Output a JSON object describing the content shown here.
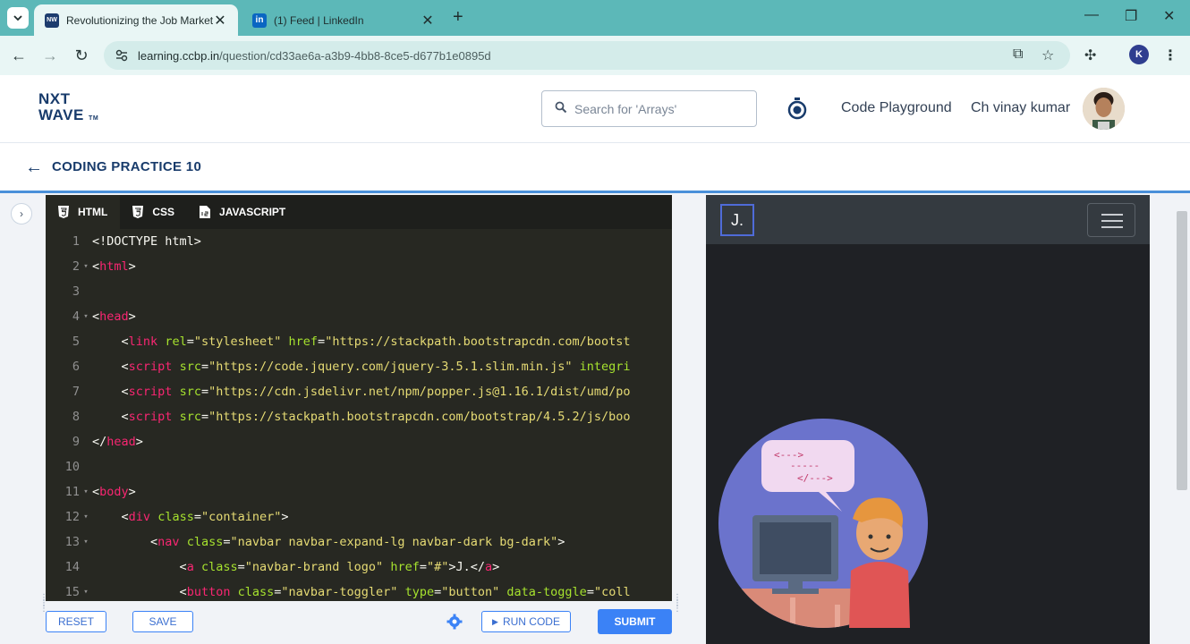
{
  "browser": {
    "tabs": [
      {
        "title": "Revolutionizing the Job Market",
        "active": true,
        "favicon": "nxtwave-favicon"
      },
      {
        "title": "(1) Feed | LinkedIn",
        "active": false,
        "favicon": "linkedin-favicon"
      }
    ],
    "url_host": "learning.ccbp.in",
    "url_path": "/question/cd33ae6a-a3b9-4bb8-8ce5-d677b1e0895d",
    "profile_initial": "K"
  },
  "header": {
    "logo_line1": "NXT",
    "logo_line2": "WAVE",
    "logo_tm": "TM",
    "search_placeholder": "Search for 'Arrays'",
    "code_playground": "Code Playground",
    "user_name": "Ch vinay kumar"
  },
  "practice": {
    "title": "CODING PRACTICE 10"
  },
  "editor": {
    "tabs": [
      {
        "label": "HTML",
        "icon": "html5-icon"
      },
      {
        "label": "CSS",
        "icon": "css3-icon"
      },
      {
        "label": "JAVASCRIPT",
        "icon": "js-file-icon"
      }
    ],
    "lines": [
      {
        "n": "1",
        "fold": "",
        "indent": "",
        "parts": [
          [
            "pl",
            "<!DOCTYPE html>"
          ]
        ]
      },
      {
        "n": "2",
        "fold": "▾",
        "indent": "",
        "parts": [
          [
            "pl",
            "<"
          ],
          [
            "tg",
            "html"
          ],
          [
            "pl",
            ">"
          ]
        ]
      },
      {
        "n": "3",
        "fold": "",
        "indent": "",
        "parts": []
      },
      {
        "n": "4",
        "fold": "▾",
        "indent": "",
        "parts": [
          [
            "pl",
            "<"
          ],
          [
            "tg",
            "head"
          ],
          [
            "pl",
            ">"
          ]
        ]
      },
      {
        "n": "5",
        "fold": "",
        "indent": "    ",
        "parts": [
          [
            "pl",
            "<"
          ],
          [
            "tg",
            "link"
          ],
          [
            "pl",
            " "
          ],
          [
            "at",
            "rel"
          ],
          [
            "pl",
            "="
          ],
          [
            "st",
            "\"stylesheet\""
          ],
          [
            "pl",
            " "
          ],
          [
            "at",
            "href"
          ],
          [
            "pl",
            "="
          ],
          [
            "st",
            "\"https://stackpath.bootstrapcdn.com/bootst"
          ]
        ]
      },
      {
        "n": "6",
        "fold": "",
        "indent": "    ",
        "parts": [
          [
            "pl",
            "<"
          ],
          [
            "tg",
            "script"
          ],
          [
            "pl",
            " "
          ],
          [
            "at",
            "src"
          ],
          [
            "pl",
            "="
          ],
          [
            "st",
            "\"https://code.jquery.com/jquery-3.5.1.slim.min.js\""
          ],
          [
            "pl",
            " "
          ],
          [
            "at",
            "integri"
          ]
        ]
      },
      {
        "n": "7",
        "fold": "",
        "indent": "    ",
        "parts": [
          [
            "pl",
            "<"
          ],
          [
            "tg",
            "script"
          ],
          [
            "pl",
            " "
          ],
          [
            "at",
            "src"
          ],
          [
            "pl",
            "="
          ],
          [
            "st",
            "\"https://cdn.jsdelivr.net/npm/popper.js@1.16.1/dist/umd/po"
          ]
        ]
      },
      {
        "n": "8",
        "fold": "",
        "indent": "    ",
        "parts": [
          [
            "pl",
            "<"
          ],
          [
            "tg",
            "script"
          ],
          [
            "pl",
            " "
          ],
          [
            "at",
            "src"
          ],
          [
            "pl",
            "="
          ],
          [
            "st",
            "\"https://stackpath.bootstrapcdn.com/bootstrap/4.5.2/js/boo"
          ]
        ]
      },
      {
        "n": "9",
        "fold": "",
        "indent": "",
        "parts": [
          [
            "pl",
            "</"
          ],
          [
            "tg",
            "head"
          ],
          [
            "pl",
            ">"
          ]
        ]
      },
      {
        "n": "10",
        "fold": "",
        "indent": "",
        "parts": []
      },
      {
        "n": "11",
        "fold": "▾",
        "indent": "",
        "parts": [
          [
            "pl",
            "<"
          ],
          [
            "tg",
            "body"
          ],
          [
            "pl",
            ">"
          ]
        ]
      },
      {
        "n": "12",
        "fold": "▾",
        "indent": "    ",
        "parts": [
          [
            "pl",
            "<"
          ],
          [
            "tg",
            "div"
          ],
          [
            "pl",
            " "
          ],
          [
            "at",
            "class"
          ],
          [
            "pl",
            "="
          ],
          [
            "st",
            "\"container\""
          ],
          [
            "pl",
            ">"
          ]
        ]
      },
      {
        "n": "13",
        "fold": "▾",
        "indent": "        ",
        "parts": [
          [
            "pl",
            "<"
          ],
          [
            "tg",
            "nav"
          ],
          [
            "pl",
            " "
          ],
          [
            "at",
            "class"
          ],
          [
            "pl",
            "="
          ],
          [
            "st",
            "\"navbar navbar-expand-lg navbar-dark bg-dark\""
          ],
          [
            "pl",
            ">"
          ]
        ]
      },
      {
        "n": "14",
        "fold": "",
        "indent": "            ",
        "parts": [
          [
            "pl",
            "<"
          ],
          [
            "tg",
            "a"
          ],
          [
            "pl",
            " "
          ],
          [
            "at",
            "class"
          ],
          [
            "pl",
            "="
          ],
          [
            "st",
            "\"navbar-brand logo\""
          ],
          [
            "pl",
            " "
          ],
          [
            "at",
            "href"
          ],
          [
            "pl",
            "="
          ],
          [
            "st",
            "\"#\""
          ],
          [
            "pl",
            ">J.</"
          ],
          [
            "tg",
            "a"
          ],
          [
            "pl",
            ">"
          ]
        ]
      },
      {
        "n": "15",
        "fold": "▾",
        "indent": "            ",
        "parts": [
          [
            "pl",
            "<"
          ],
          [
            "tg",
            "button"
          ],
          [
            "pl",
            " "
          ],
          [
            "at",
            "class"
          ],
          [
            "pl",
            "="
          ],
          [
            "st",
            "\"navbar-toggler\""
          ],
          [
            "pl",
            " "
          ],
          [
            "at",
            "type"
          ],
          [
            "pl",
            "="
          ],
          [
            "st",
            "\"button\""
          ],
          [
            "pl",
            " "
          ],
          [
            "at",
            "data-toggle"
          ],
          [
            "pl",
            "="
          ],
          [
            "st",
            "\"coll"
          ]
        ]
      }
    ],
    "reset_label": "RESET",
    "save_label": "SAVE",
    "run_label": "RUN CODE",
    "submit_label": "SUBMIT"
  },
  "preview": {
    "brand": "J."
  },
  "colors": {
    "tab_strip": "#5cb8b8",
    "brand_blue": "#183b6b",
    "accent_blue": "#3b82f6",
    "editor_bg": "#272822",
    "preview_bg": "#1f2125",
    "navbar_dark": "#343a40"
  }
}
